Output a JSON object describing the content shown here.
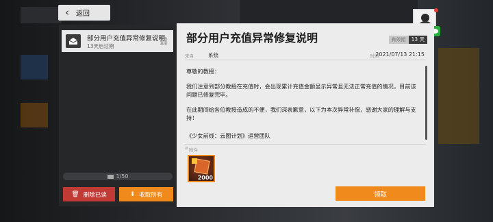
{
  "nav": {
    "back_label": "返回"
  },
  "mail_list": {
    "items": [
      {
        "title": "部分用户充值异常修复说明",
        "expire": "13天后过期",
        "icon": "mail-open-icon"
      }
    ],
    "count": "1/50",
    "delete_read_label": "删除已读",
    "claim_all_label": "收取所有"
  },
  "mail": {
    "title": "部分用户充值异常修复说明",
    "validity_label": "有效期",
    "validity_value": "13 天",
    "sender_label": "来自",
    "sender": "系统",
    "time_label": "时间",
    "time": "2021/07/13 21:15",
    "greeting": "尊敬的教授：",
    "paragraph1": "我们注意到部分教授在充值时，会出现累计充值金额显示异常且无法正常充值的情况，目前该问题已修复完毕。",
    "paragraph2": "在此期间给各位教授造成的不便，我们深表歉意，以下为本次异常补偿，感谢大家的理解与支持！",
    "signature": "《少女前线：云图计划》运营团队",
    "attachment_label": "附件",
    "attachments": [
      {
        "quantity": "2000",
        "icon": "crystal-currency-icon"
      }
    ],
    "claim_label": "领取"
  },
  "colors": {
    "accent": "#f08a1d",
    "danger": "#c23a36"
  }
}
